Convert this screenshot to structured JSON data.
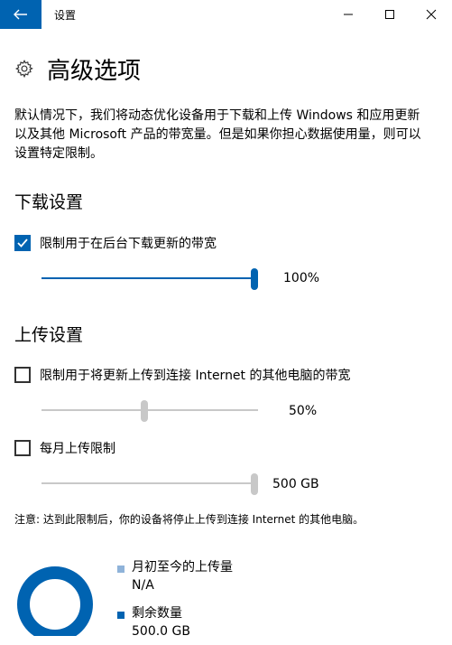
{
  "window": {
    "title": "设置"
  },
  "header": {
    "title": "高级选项",
    "icon": "gear-icon"
  },
  "description": "默认情况下，我们将动态优化设备用于下载和上传 Windows 和应用更新以及其他 Microsoft 产品的带宽量。但是如果你担心数据使用量，则可以设置特定限制。",
  "download": {
    "title": "下载设置",
    "limit_label": "限制用于在后台下载更新的带宽",
    "limit_checked": true,
    "bandwidth_percent": 100,
    "bandwidth_text": "100%"
  },
  "upload": {
    "title": "上传设置",
    "limit_label": "限制用于将更新上传到连接 Internet 的其他电脑的带宽",
    "limit_checked": false,
    "bandwidth_percent": 50,
    "bandwidth_text": "50%",
    "monthly_label": "每月上传限制",
    "monthly_checked": false,
    "monthly_value": 500,
    "monthly_text": "500 GB",
    "note": "注意: 达到此限制后，你的设备将停止上传到连接 Internet 的其他电脑。"
  },
  "usage": {
    "uploaded_label": "月初至今的上传量",
    "uploaded_value": "N/A",
    "remaining_label": "剩余数量",
    "remaining_value": "500.0 GB",
    "colors": {
      "uploaded": "#8fb3d9",
      "remaining": "#0063b1"
    }
  },
  "colors": {
    "accent": "#0063b1",
    "track": "#c8c8c8"
  }
}
